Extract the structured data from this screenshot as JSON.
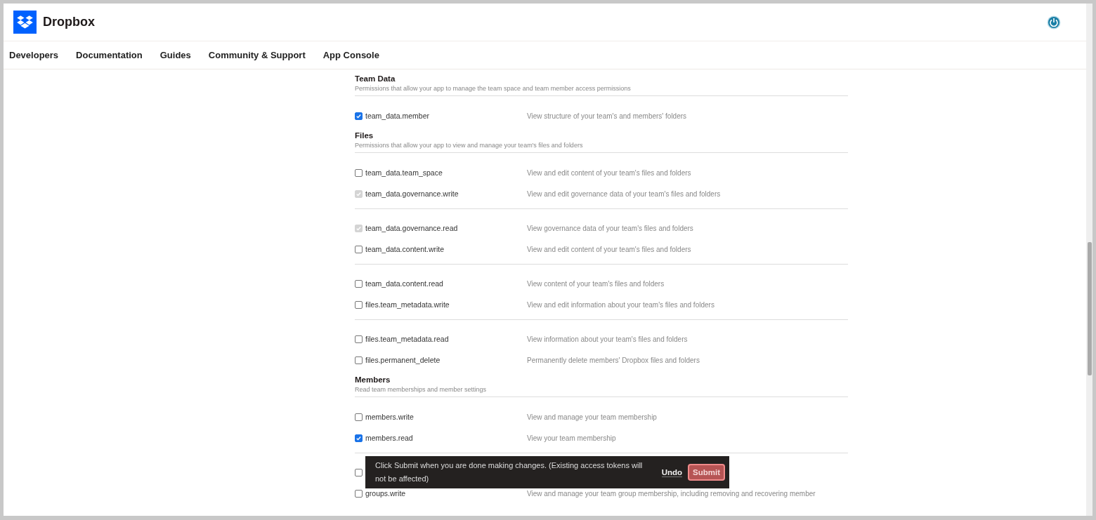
{
  "header": {
    "brand": "Dropbox"
  },
  "nav": [
    "Developers",
    "Documentation",
    "Guides",
    "Community & Support",
    "App Console"
  ],
  "sections": [
    {
      "title": "Team Data",
      "subtitle": "Permissions that allow your app to manage the team space and team member access permissions",
      "blocks": [
        {
          "rows": [
            {
              "scope": "team_data.member",
              "description": "View structure of your team's and members' folders",
              "checked": true,
              "disabled": false
            }
          ]
        }
      ]
    },
    {
      "title": "Files",
      "subtitle": "Permissions that allow your app to view and manage your team's files and folders",
      "blocks": [
        {
          "rows": [
            {
              "scope": "team_data.team_space",
              "description": "View and edit content of your team's files and folders",
              "checked": false,
              "disabled": false
            },
            {
              "scope": "team_data.governance.write",
              "description": "View and edit governance data of your team's files and folders",
              "checked": true,
              "disabled": true
            }
          ]
        },
        {
          "rows": [
            {
              "scope": "team_data.governance.read",
              "description": "View governance data of your team's files and folders",
              "checked": true,
              "disabled": true
            },
            {
              "scope": "team_data.content.write",
              "description": "View and edit content of your team's files and folders",
              "checked": false,
              "disabled": false
            }
          ]
        },
        {
          "rows": [
            {
              "scope": "team_data.content.read",
              "description": "View content of your team's files and folders",
              "checked": false,
              "disabled": false
            },
            {
              "scope": "files.team_metadata.write",
              "description": "View and edit information about your team's files and folders",
              "checked": false,
              "disabled": false
            }
          ]
        },
        {
          "rows": [
            {
              "scope": "files.team_metadata.read",
              "description": "View information about your team's files and folders",
              "checked": false,
              "disabled": false
            },
            {
              "scope": "files.permanent_delete",
              "description": "Permanently delete members' Dropbox files and folders",
              "checked": false,
              "disabled": false
            }
          ]
        }
      ]
    },
    {
      "title": "Members",
      "subtitle": "Read team memberships and member settings",
      "blocks": [
        {
          "rows": [
            {
              "scope": "members.write",
              "description": "View and manage your team membership",
              "checked": false,
              "disabled": false
            },
            {
              "scope": "members.read",
              "description": "View your team membership",
              "checked": true,
              "disabled": false
            }
          ]
        },
        {
          "rows": [
            {
              "checked": false,
              "disabled": false
            },
            {
              "scope": "groups.write",
              "description": "View and manage your team group membership, including removing and recovering member",
              "checked": false,
              "disabled": false
            }
          ]
        }
      ]
    }
  ],
  "toast": {
    "message": "Click Submit when you are done making changes. (Existing access tokens will not be affected)",
    "undo": "Undo",
    "submit": "Submit"
  }
}
